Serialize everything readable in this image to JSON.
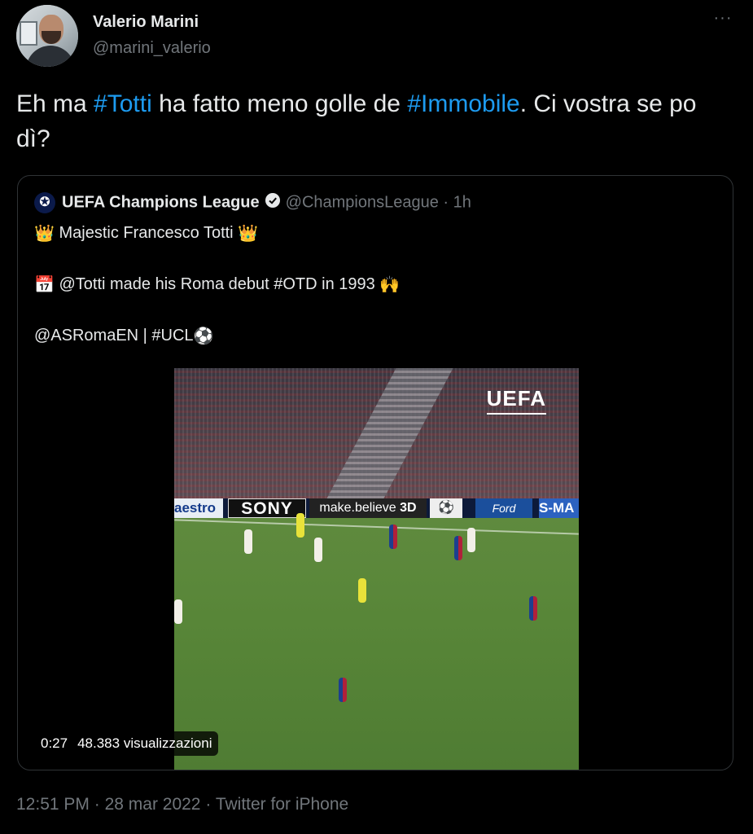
{
  "author": {
    "name": "Valerio Marini",
    "handle": "@marini_valerio",
    "more_icon": "···"
  },
  "tweet": {
    "parts": [
      {
        "text": "Eh ma ",
        "tag": false
      },
      {
        "text": "#Totti",
        "tag": true
      },
      {
        "text": " ha fatto meno golle de ",
        "tag": false
      },
      {
        "text": "#Immobile",
        "tag": true
      },
      {
        "text": ". Ci vostra se po dì?",
        "tag": false
      }
    ]
  },
  "quote": {
    "name": "UEFA Champions League",
    "handle": "@ChampionsLeague",
    "separator": "·",
    "time": "1h",
    "lines": {
      "line1": "Majestic Francesco Totti",
      "line2": "@Totti made his Roma debut #OTD in 1993",
      "line3": "@ASRomaEN | #UCL"
    },
    "emoji": {
      "crown": "👑",
      "calendar": "📅",
      "raised_hands": "🙌",
      "ball": "⚽"
    },
    "video": {
      "watermark": "UEFA",
      "boards": {
        "b1": "aestro",
        "b2": "SONY",
        "b3": "make.believe",
        "b3d": "3D",
        "b5": "Ford",
        "b6": "S-MA"
      },
      "duration": "0:27",
      "views": "48.383 visualizzazioni"
    }
  },
  "meta": {
    "time": "12:51 PM",
    "sep1": "·",
    "date": "28 mar 2022",
    "sep2": "·",
    "source": "Twitter for iPhone"
  },
  "colors": {
    "background": "#000000",
    "text": "#e7e9ea",
    "secondary": "#71767b",
    "link": "#1d9bf0",
    "border": "#2f3336"
  }
}
